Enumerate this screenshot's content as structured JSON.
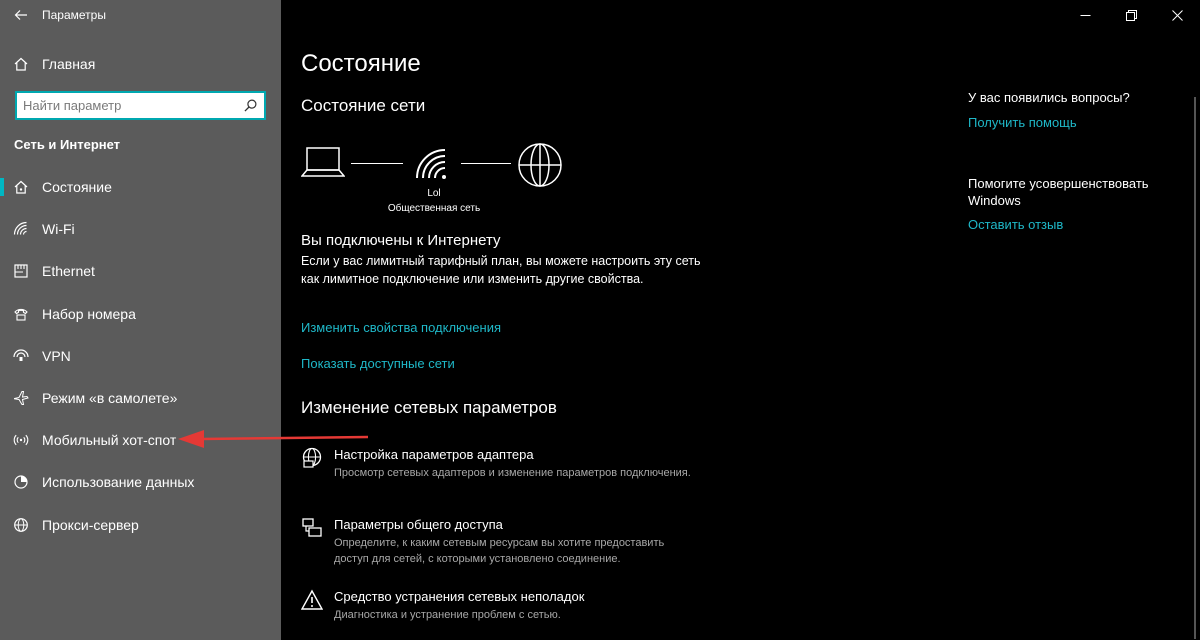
{
  "window": {
    "title": "Параметры"
  },
  "sidebar": {
    "home_label": "Главная",
    "search_placeholder": "Найти параметр",
    "section_title": "Сеть и Интернет",
    "items": [
      {
        "label": "Состояние",
        "icon": "home-network-icon",
        "active": true
      },
      {
        "label": "Wi-Fi",
        "icon": "wifi-icon"
      },
      {
        "label": "Ethernet",
        "icon": "ethernet-icon"
      },
      {
        "label": "Набор номера",
        "icon": "dialup-icon"
      },
      {
        "label": "VPN",
        "icon": "vpn-icon"
      },
      {
        "label": "Режим «в самолете»",
        "icon": "airplane-icon"
      },
      {
        "label": "Мобильный хот-спот",
        "icon": "hotspot-icon"
      },
      {
        "label": "Использование данных",
        "icon": "data-usage-icon"
      },
      {
        "label": "Прокси-сервер",
        "icon": "globe-icon"
      }
    ]
  },
  "main": {
    "title": "Состояние",
    "network_status_title": "Состояние сети",
    "network": {
      "name": "Lol",
      "type": "Общественная сеть"
    },
    "connected_title": "Вы подключены к Интернету",
    "connected_desc": "Если у вас лимитный тарифный план, вы можете настроить эту сеть как лимитное подключение или изменить другие свойства.",
    "link_change_props": "Изменить свойства подключения",
    "link_show_networks": "Показать доступные сети",
    "change_settings_title": "Изменение сетевых параметров",
    "settings": [
      {
        "title": "Настройка параметров адаптера",
        "desc": "Просмотр сетевых адаптеров и изменение параметров подключения.",
        "icon": "adapter-icon"
      },
      {
        "title": "Параметры общего доступа",
        "desc": "Определите, к каким сетевым ресурсам вы хотите предоставить доступ для сетей, с которыми установлено соединение.",
        "icon": "sharing-icon"
      },
      {
        "title": "Средство устранения сетевых неполадок",
        "desc": "Диагностика и устранение проблем с сетью.",
        "icon": "warning-icon"
      }
    ]
  },
  "right": {
    "question": "У вас появились вопросы?",
    "get_help": "Получить помощь",
    "improve": "Помогите усовершенствовать Windows",
    "feedback": "Оставить отзыв"
  },
  "colors": {
    "sidebar_bg": "#5b5b5b",
    "main_bg": "#000000",
    "accent": "#1fb8c8",
    "annotation_arrow": "#e53935"
  }
}
